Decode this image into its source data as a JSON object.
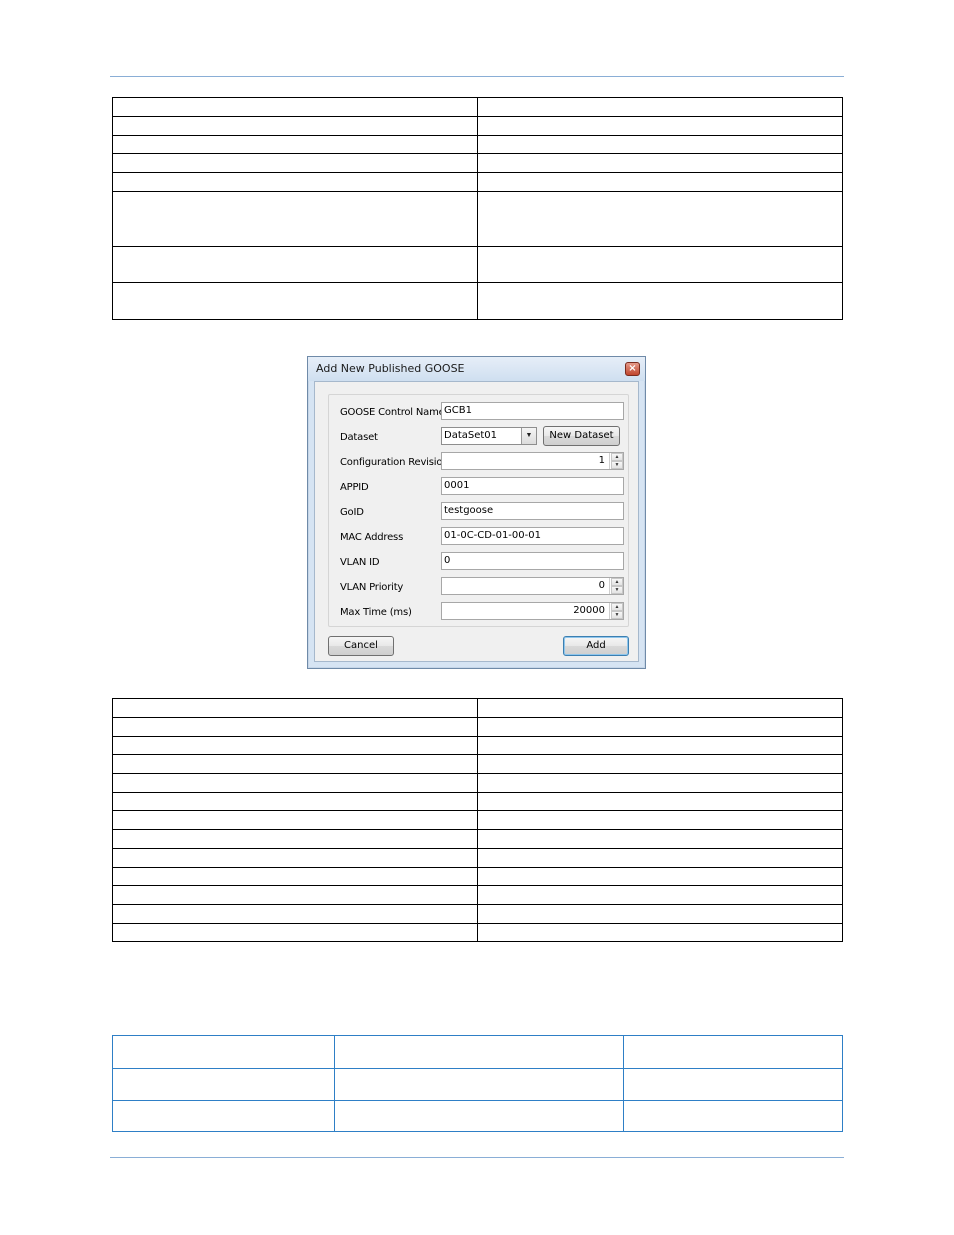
{
  "dialog": {
    "title": "Add New Published GOOSE",
    "close_glyph": "×",
    "fields": {
      "goose_control_name": {
        "label": "GOOSE Control Name",
        "value": "GCB1"
      },
      "dataset": {
        "label": "Dataset",
        "value": "DataSet01",
        "new_button": "New Dataset"
      },
      "configuration_revision": {
        "label": "Configuration Revision",
        "value": "1"
      },
      "appid": {
        "label": "APPID",
        "value": "0001"
      },
      "goid": {
        "label": "GoID",
        "value": "testgoose"
      },
      "mac_address": {
        "label": "MAC Address",
        "value": "01-0C-CD-01-00-01"
      },
      "vlan_id": {
        "label": "VLAN ID",
        "value": "0"
      },
      "vlan_priority": {
        "label": "VLAN Priority",
        "value": "0"
      },
      "max_time": {
        "label": "Max Time (ms)",
        "value": "20000"
      }
    },
    "buttons": {
      "cancel": "Cancel",
      "add": "Add"
    }
  },
  "icons": {
    "close": "close-icon",
    "dropdown": "chevron-down-icon",
    "spin_up": "spin-up-icon",
    "spin_down": "spin-down-icon"
  },
  "colors": {
    "rule": "#8aaed6",
    "table3_border": "#2e7fc6"
  }
}
